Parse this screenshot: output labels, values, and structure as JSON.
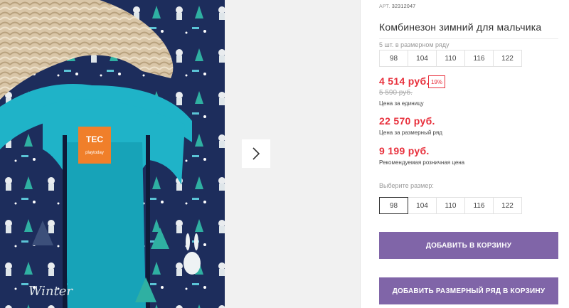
{
  "product": {
    "article_label": "АРТ.",
    "article_number": "32312047",
    "title": "Комбинезон зимний для мальчика",
    "size_row_note": "5 шт. в размерном ряду",
    "size_row": [
      "98",
      "104",
      "110",
      "116",
      "122"
    ],
    "price_unit": "4 514 руб.",
    "discount": "19%",
    "old_price": "5 590 руб.",
    "price_unit_label": "Цена за единицу",
    "price_row": "22 570 руб.",
    "price_row_label": "Цена за размерный ряд",
    "price_retail": "9 199 руб.",
    "price_retail_label": "Рекомендуемая розничная цена",
    "choose_size_label": "Выберите размер:",
    "sizes": [
      "98",
      "104",
      "110",
      "116",
      "122"
    ],
    "selected_size": "98",
    "add_to_cart": "ДОБАВИТЬ В КОРЗИНУ",
    "add_row_to_cart": "ДОБАВИТЬ РАЗМЕРНЫЙ РЯД В КОРЗИНУ"
  },
  "photo_label": {
    "brand": "TEC",
    "tag": "playtoday",
    "print_text": "Winter"
  },
  "colors": {
    "price": "#e8303c",
    "button": "#8065a8",
    "fabric": "#1d2d5c",
    "lining": "#1fb3c8",
    "label": "#f07f2a"
  },
  "icons": {
    "next": "chevron-right-icon"
  }
}
